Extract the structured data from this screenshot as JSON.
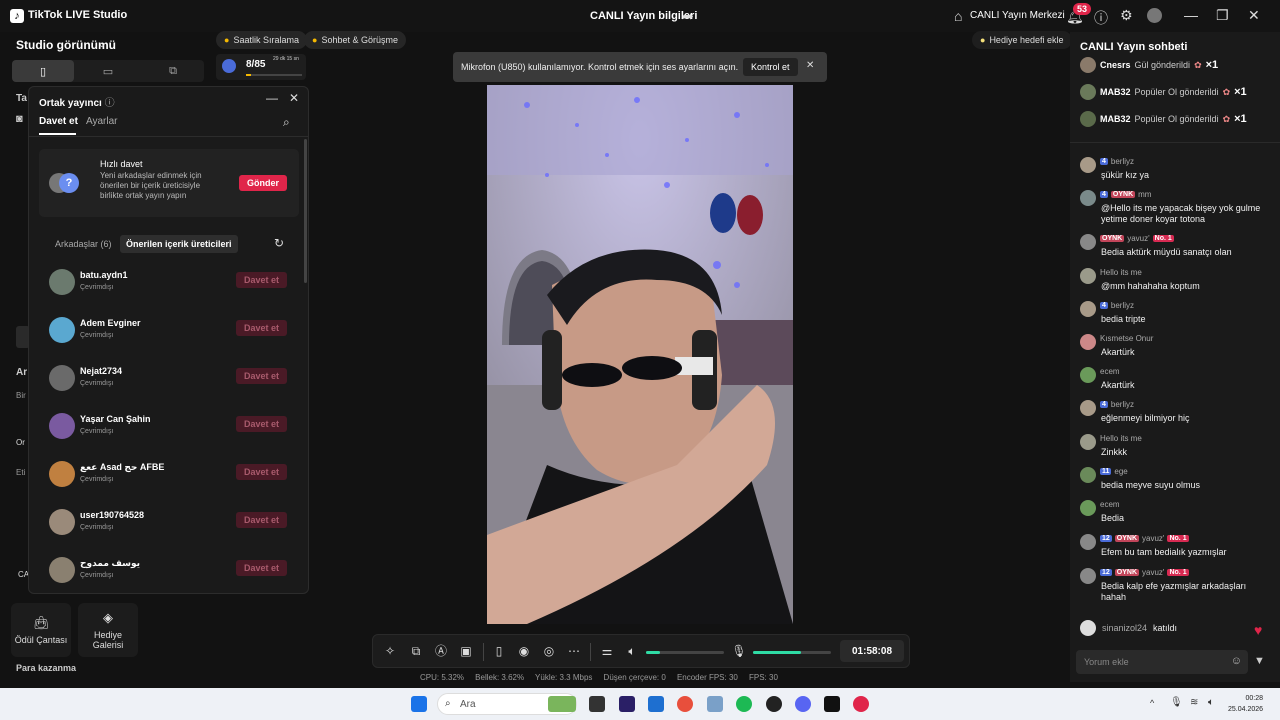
{
  "titlebar": {
    "app_name": "TikTok LIVE Studio",
    "center_title": "CANLI Yayın bilgileri",
    "live_center": "CANLI Yayın Merkezi",
    "notif_count": "53"
  },
  "left": {
    "studio_view": "Studio görünümü",
    "reward_bag": "Ödül Çantası",
    "gift_gallery": "Hediye Galerisi",
    "earn_money": "Para kazanma",
    "cut_labels": [
      "Ta",
      "Ar",
      "Bir",
      "Or",
      "Eti",
      "CA"
    ]
  },
  "pills": {
    "hourly": "Saatlik Sıralama",
    "chat_meet": "Sohbet & Görüşme",
    "progress": "8/85",
    "progress_time": "29 dk 15 sn",
    "progress_fraction": 0.094
  },
  "gift_goal": "Hediye hedefi ekle",
  "cohost": {
    "title": "Ortak yayıncı",
    "tab_invite": "Davet et",
    "tab_settings": "Ayarlar",
    "quick_title": "Hızlı davet",
    "quick_desc": "Yeni arkadaşlar edinmek için önerilen bir içerik üreticisiyle birlikte ortak yayın yapın",
    "send": "Gönder",
    "subtab_friends": "Arkadaşlar (6)",
    "subtab_suggested": "Önerilen içerik üreticileri",
    "friends": [
      {
        "name": "batu.aydn1",
        "status": "Çevrimdışı",
        "btn": "Davet et",
        "color": "#6b7a6e"
      },
      {
        "name": "Adem Evginer",
        "status": "Çevrimdışı",
        "btn": "Davet et",
        "color": "#5aa8d0"
      },
      {
        "name": "Nejat2734",
        "status": "Çevrimdışı",
        "btn": "Davet et",
        "color": "#6a6a6a"
      },
      {
        "name": "Yaşar Can Şahin",
        "status": "Çevrimdışı",
        "btn": "Davet et",
        "color": "#7a5aa0"
      },
      {
        "name": "ععع Asad حج AFBE",
        "status": "Çevrimdışı",
        "btn": "Davet et",
        "color": "#c08040"
      },
      {
        "name": "user190764528",
        "status": "Çevrimdışı",
        "btn": "Davet et",
        "color": "#9a8a7a"
      },
      {
        "name": "يوسف ممدوح",
        "status": "Çevrimdışı",
        "btn": "Davet et",
        "color": "#8a8070"
      }
    ]
  },
  "toast": {
    "text": "Mikrofon (U850) kullanılamıyor. Kontrol etmek için ses ayarlarını açın.",
    "button": "Kontrol et"
  },
  "controls": {
    "timer": "01:58:08",
    "volume_level": 0.18,
    "mic_level": 0.62
  },
  "stats": {
    "cpu": "CPU:  5.32%",
    "memory": "Bellek:  3.62%",
    "upload": "Yükle:  3.3 Mbps",
    "dropped": "Düşen çerçeve:  0",
    "encoder_fps": "Encoder FPS:  30",
    "fps": "FPS:  30"
  },
  "chat": {
    "title": "CANLI Yayın sohbeti",
    "gifts": [
      {
        "user": "Cnesrs",
        "text": "Gül gönderildi",
        "mult": "×1"
      },
      {
        "user": "MAB32",
        "text": "Popüler Ol gönderildi",
        "mult": "×1"
      },
      {
        "user": "MAB32",
        "text": "Popüler Ol gönderildi",
        "mult": "×1"
      }
    ],
    "messages": [
      {
        "user": "berliyz",
        "lvl": "4",
        "fan": "",
        "no1": "",
        "text": "şükür kız ya"
      },
      {
        "user": "mm",
        "lvl": "4",
        "fan": "OYNK",
        "no1": "",
        "text": "@Hello its me yapacak bişey yok gulme yetime doner koyar totona"
      },
      {
        "user": "yavuz'",
        "lvl": "",
        "fan": "OYNK",
        "no1": "No. 1",
        "text": "Bedia aktürk müydü sanatçı olan"
      },
      {
        "user": "Hello its me",
        "lvl": "",
        "fan": "",
        "no1": "",
        "text": "@mm hahahaha koptum"
      },
      {
        "user": "berliyz",
        "lvl": "4",
        "fan": "",
        "no1": "",
        "text": "bedia tripte"
      },
      {
        "user": "Kısmetse Onur",
        "lvl": "",
        "fan": "",
        "no1": "",
        "text": "Akartürk"
      },
      {
        "user": "ecem",
        "lvl": "",
        "fan": "",
        "no1": "",
        "text": "Akartürk"
      },
      {
        "user": "berliyz",
        "lvl": "4",
        "fan": "",
        "no1": "",
        "text": "eğlenmeyi bilmiyor hiç"
      },
      {
        "user": "Hello its me",
        "lvl": "",
        "fan": "",
        "no1": "",
        "text": "Zinkkk"
      },
      {
        "user": "ege",
        "lvl": "11",
        "fan": "",
        "no1": "",
        "text": "bedia meyve suyu olmus"
      },
      {
        "user": "ecem",
        "lvl": "",
        "fan": "",
        "no1": "",
        "text": "Bedia"
      },
      {
        "user": "yavuz'",
        "lvl": "12",
        "fan": "OYNK",
        "no1": "No. 1",
        "text": "Efem bu tam bedialık yazmışlar"
      },
      {
        "user": "yavuz'",
        "lvl": "12",
        "fan": "OYNK",
        "no1": "No. 1",
        "text": "Bedia kalp efe yazmışlar arkadaşları hahah"
      }
    ],
    "joined_user": "sinanizol24",
    "joined_text": "katıldı",
    "input_placeholder": "Yorum ekle"
  },
  "taskbar": {
    "search": "Ara",
    "time": "00:28",
    "date": "25.04.2026"
  }
}
